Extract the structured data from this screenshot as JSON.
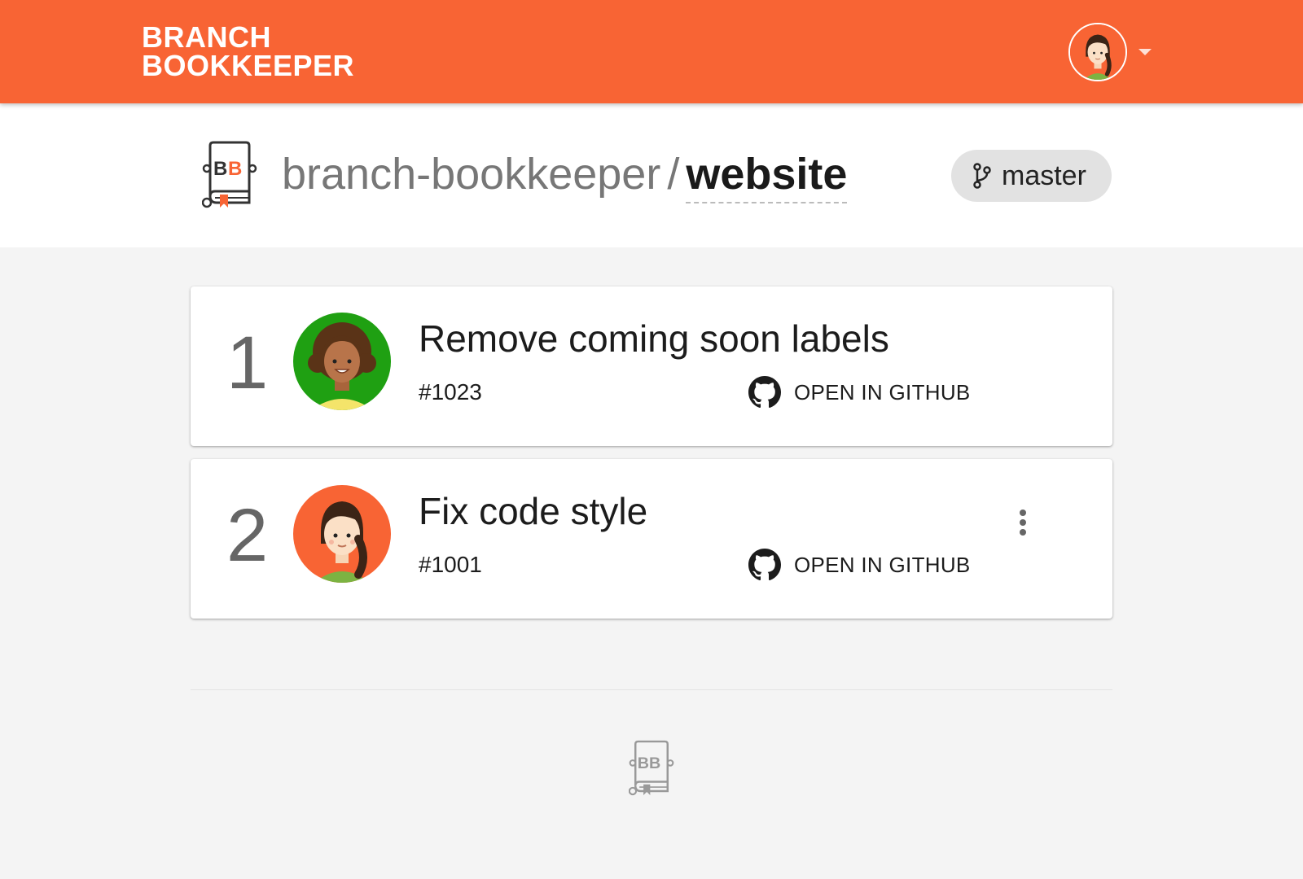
{
  "brand": {
    "line1": "BRANCH",
    "line2": "BOOKKEEPER"
  },
  "colors": {
    "appbar": "#f86434",
    "chip": "#e2e2e2",
    "logo_accent": "#f86434"
  },
  "user_menu": {
    "avatar_icon": "user-avatar-icon",
    "caret_icon": "caret-down-icon"
  },
  "repo": {
    "logo_text": "BB",
    "owner": "branch-bookkeeper",
    "separator": "/",
    "name": "website",
    "branch": "master",
    "branch_icon": "git-branch-icon"
  },
  "pull_requests": [
    {
      "index": "1",
      "title": "Remove coming soon labels",
      "number": "#1023",
      "github_link_label": "OPEN IN GITHUB",
      "avatar_bg": "#1fa012",
      "has_menu": false
    },
    {
      "index": "2",
      "title": "Fix code style",
      "number": "#1001",
      "github_link_label": "OPEN IN GITHUB",
      "avatar_bg": "#f86434",
      "has_menu": true,
      "menu_icon": "more-vert-icon"
    }
  ],
  "footer": {
    "logo_text": "BB"
  }
}
